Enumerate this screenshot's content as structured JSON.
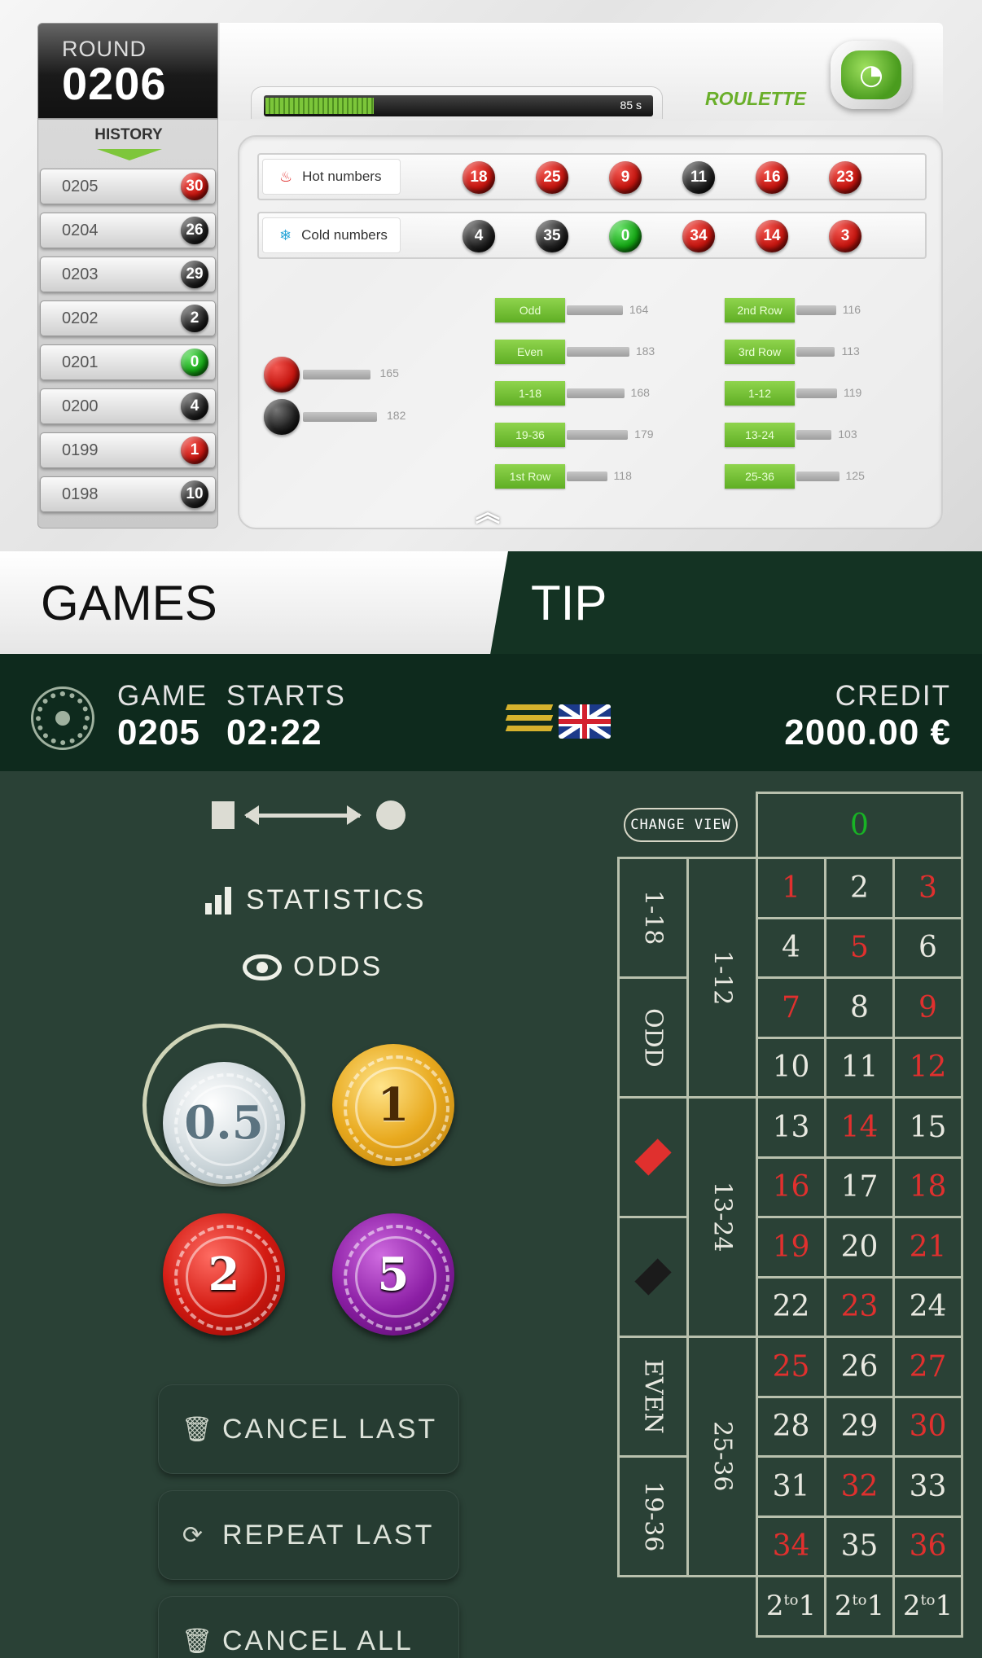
{
  "round": {
    "label": "ROUND",
    "number": "0206"
  },
  "history": {
    "title": "HISTORY",
    "rows": [
      {
        "round": "0205",
        "result": "30",
        "color": "red"
      },
      {
        "round": "0204",
        "result": "26",
        "color": "black"
      },
      {
        "round": "0203",
        "result": "29",
        "color": "black"
      },
      {
        "round": "0202",
        "result": "2",
        "color": "black"
      },
      {
        "round": "0201",
        "result": "0",
        "color": "green"
      },
      {
        "round": "0200",
        "result": "4",
        "color": "black"
      },
      {
        "round": "0199",
        "result": "1",
        "color": "red"
      },
      {
        "round": "0198",
        "result": "10",
        "color": "black"
      }
    ]
  },
  "timer": {
    "text": "85 s",
    "progress": 0.28
  },
  "game_title": "ROULETTE",
  "hot": {
    "label": "Hot numbers",
    "numbers": [
      {
        "n": "18",
        "color": "red"
      },
      {
        "n": "25",
        "color": "red"
      },
      {
        "n": "9",
        "color": "red"
      },
      {
        "n": "11",
        "color": "black"
      },
      {
        "n": "16",
        "color": "red"
      },
      {
        "n": "23",
        "color": "red"
      }
    ]
  },
  "cold": {
    "label": "Cold numbers",
    "numbers": [
      {
        "n": "4",
        "color": "black"
      },
      {
        "n": "35",
        "color": "black"
      },
      {
        "n": "0",
        "color": "green"
      },
      {
        "n": "34",
        "color": "red"
      },
      {
        "n": "14",
        "color": "red"
      },
      {
        "n": "3",
        "color": "red"
      }
    ]
  },
  "color_stats": [
    {
      "color": "red",
      "value": "165"
    },
    {
      "color": "black",
      "value": "182"
    }
  ],
  "bet_stats_left": [
    {
      "label": "Odd",
      "value": "164"
    },
    {
      "label": "Even",
      "value": "183"
    },
    {
      "label": "1-18",
      "value": "168"
    },
    {
      "label": "19-36",
      "value": "179"
    },
    {
      "label": "1st Row",
      "value": "118"
    }
  ],
  "bet_stats_right": [
    {
      "label": "2nd Row",
      "value": "116"
    },
    {
      "label": "3rd Row",
      "value": "113"
    },
    {
      "label": "1-12",
      "value": "119"
    },
    {
      "label": "13-24",
      "value": "103"
    },
    {
      "label": "25-36",
      "value": "125"
    }
  ],
  "tabs": {
    "games": "GAMES",
    "tip": "TIP"
  },
  "info": {
    "game_label": "GAME",
    "game_value": "0205",
    "starts_label": "STARTS",
    "starts_value": "02:22",
    "credit_label": "CREDIT",
    "credit_value": "2000.00 €"
  },
  "links": {
    "statistics": "STATISTICS",
    "odds": "ODDS"
  },
  "chips": {
    "c05": "0.5",
    "c1": "1",
    "c2": "2",
    "c5": "5"
  },
  "actions": {
    "cancel_last": "CANCEL LAST",
    "repeat_last": "REPEAT LAST",
    "cancel_all": "CANCEL ALL"
  },
  "board": {
    "change_view": "CHANGE VIEW",
    "zero": "0",
    "numbers": [
      [
        "1",
        "2",
        "3"
      ],
      [
        "4",
        "5",
        "6"
      ],
      [
        "7",
        "8",
        "9"
      ],
      [
        "10",
        "11",
        "12"
      ],
      [
        "13",
        "14",
        "15"
      ],
      [
        "16",
        "17",
        "18"
      ],
      [
        "19",
        "20",
        "21"
      ],
      [
        "22",
        "23",
        "24"
      ],
      [
        "25",
        "26",
        "27"
      ],
      [
        "28",
        "29",
        "30"
      ],
      [
        "31",
        "32",
        "33"
      ],
      [
        "34",
        "35",
        "36"
      ]
    ],
    "red_numbers": [
      "1",
      "3",
      "5",
      "7",
      "9",
      "12",
      "14",
      "16",
      "18",
      "19",
      "21",
      "23",
      "25",
      "27",
      "30",
      "32",
      "34",
      "36"
    ],
    "dozens": [
      "1-12",
      "13-24",
      "25-36"
    ],
    "outside": {
      "low": "1-18",
      "odd": "ODD",
      "even": "EVEN",
      "high": "19-36"
    },
    "column_bet": "2to1",
    "colors": {
      "red": "#e0302e",
      "black": "#1b1b1b",
      "green": "#18b325"
    }
  }
}
